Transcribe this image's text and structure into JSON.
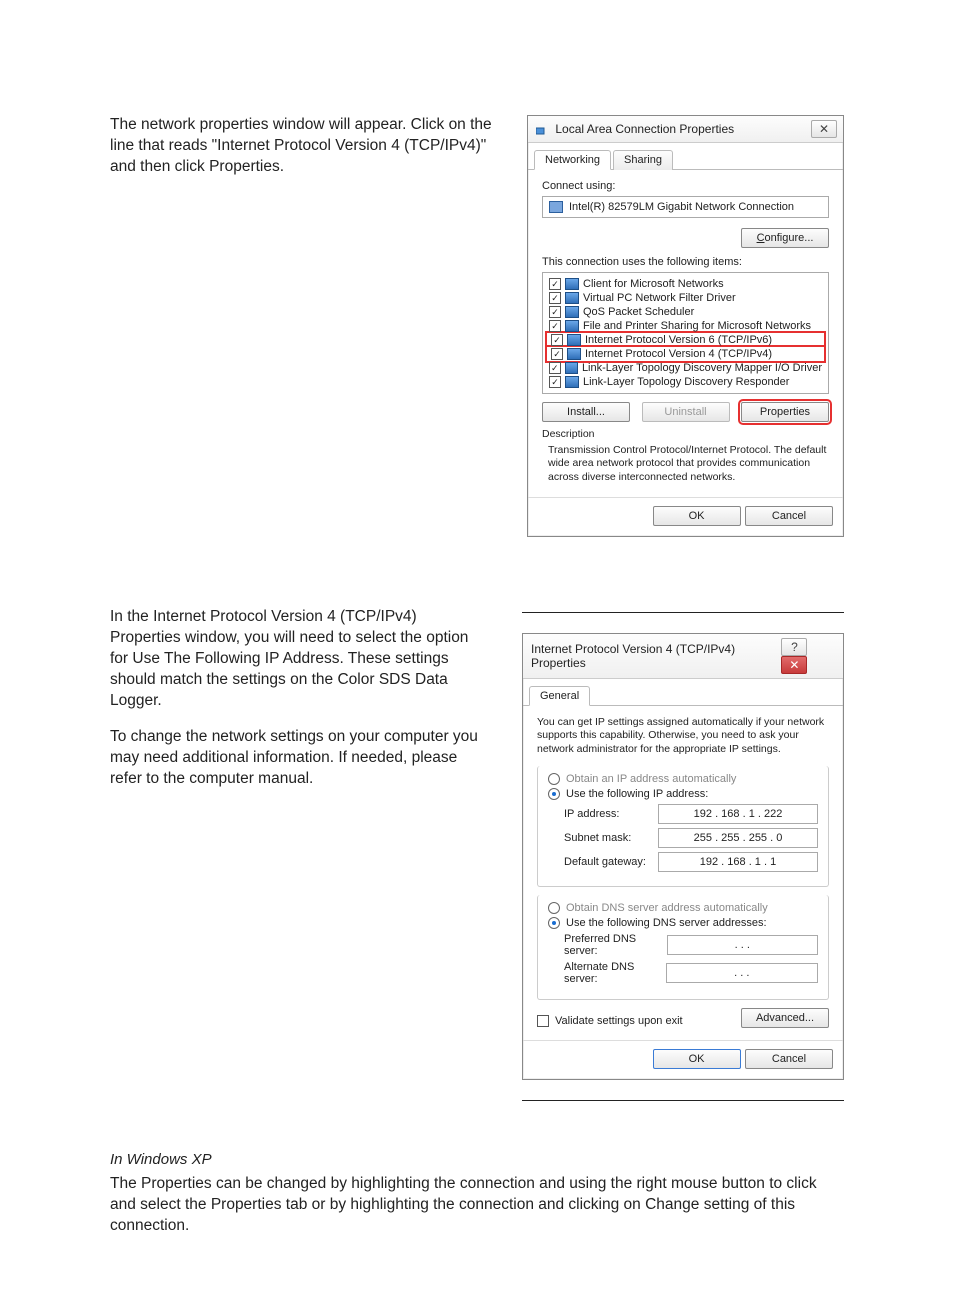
{
  "doc": {
    "p1": "The network properties window will appear. Click on the line that reads \"Internet Protocol Version 4 (TCP/IPv4)\" and then click Properties.",
    "p2": "In the Internet Protocol Version 4 (TCP/IPv4) Properties window, you will need to select the option for Use The Following IP Address.  These settings should match the settings on the Color SDS Data Logger.",
    "p3": "To change the network settings on your computer you may need additional information. If needed, please refer to the computer manual.",
    "xp_head": "In Windows XP",
    "xp_body": "The Properties can be changed by highlighting the connection and using the right mouse button to click and select the Properties tab or by highlighting the connection and clicking on Change setting of this connection."
  },
  "dlg1": {
    "title": "Local Area Connection Properties",
    "tabs": {
      "networking": "Networking",
      "sharing": "Sharing"
    },
    "connect_using": "Connect using:",
    "nic": "Intel(R) 82579LM Gigabit Network Connection",
    "configure": "Configure...",
    "uses_items": "This connection uses the following items:",
    "items": [
      "Client for Microsoft Networks",
      "Virtual PC Network Filter Driver",
      "QoS Packet Scheduler",
      "File and Printer Sharing for Microsoft Networks",
      "Internet Protocol Version 6 (TCP/IPv6)",
      "Internet Protocol Version 4 (TCP/IPv4)",
      "Link-Layer Topology Discovery Mapper I/O Driver",
      "Link-Layer Topology Discovery Responder"
    ],
    "install": "Install...",
    "uninstall": "Uninstall",
    "properties": "Properties",
    "desc_h": "Description",
    "desc": "Transmission Control Protocol/Internet Protocol. The default wide area network protocol that provides communication across diverse interconnected networks.",
    "ok": "OK",
    "cancel": "Cancel"
  },
  "dlg2": {
    "title": "Internet Protocol Version 4 (TCP/IPv4) Properties",
    "tab_general": "General",
    "intro": "You can get IP settings assigned automatically if your network supports this capability. Otherwise, you need to ask your network administrator for the appropriate IP settings.",
    "r1a": "Obtain an IP address automatically",
    "r1b": "Use the following IP address:",
    "ip_l": "IP address:",
    "ip_v": "192 . 168 .   1  . 222",
    "sm_l": "Subnet mask:",
    "sm_v": "255 . 255 . 255 .   0",
    "gw_l": "Default gateway:",
    "gw_v": "192 . 168 .   1  .   1",
    "r2a": "Obtain DNS server address automatically",
    "r2b": "Use the following DNS server addresses:",
    "pdns_l": "Preferred DNS server:",
    "adns_l": "Alternate DNS server:",
    "dns_blank": ".       .       .",
    "validate": "Validate settings upon exit",
    "advanced": "Advanced...",
    "ok": "OK",
    "cancel": "Cancel"
  }
}
